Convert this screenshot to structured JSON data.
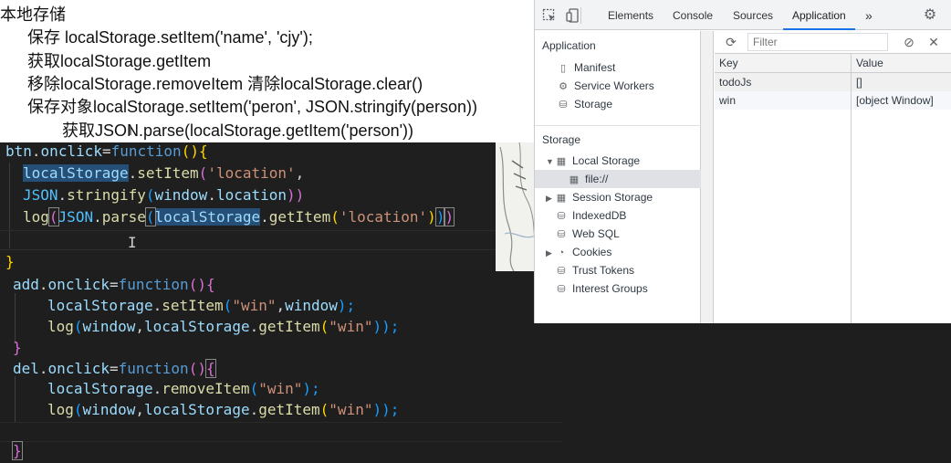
{
  "notes": {
    "heading": "本地存储",
    "lines": [
      "保存 localStorage.setItem('name', 'cjy');",
      "获取localStorage.getItem",
      "移除localStorage.removeItem  清除localStorage.clear()",
      "保存对象localStorage.setItem('peron', JSON.stringify(person))",
      "获取JSON.parse(localStorage.getItem('person'))"
    ]
  },
  "editor1": {
    "line1": {
      "a": "btn",
      "b": ".",
      "c": "onclick",
      "d": "=",
      "e": "function",
      "f": "(){"
    },
    "line2": {
      "a": "localStorage",
      "b": ".",
      "c": "setItem",
      "d": "(",
      "e": "'location'",
      "f": ","
    },
    "line3": {
      "a": "JSON",
      "b": ".",
      "c": "stringify",
      "d": "(",
      "e": "window",
      "f": ".",
      "g": "location",
      "h": "))"
    },
    "line4": {
      "a": "log",
      "b": "(",
      "c": "JSON",
      "d": ".",
      "e": "parse",
      "f": "(",
      "g": "localStorage",
      "h": ".",
      "i": "getItem",
      "j": "(",
      "k": "'location'",
      "l": ")",
      "m": ")",
      "n": ")"
    },
    "line5": "}"
  },
  "editor2": {
    "line1": {
      "a": "add",
      "b": ".",
      "c": "onclick",
      "d": "=",
      "e": "function",
      "f": "(){"
    },
    "line2": {
      "a": "localStorage",
      "b": ".",
      "c": "setItem",
      "d": "(",
      "e": "\"win\"",
      "f": ",",
      "g": "window",
      "h": ");"
    },
    "line3": {
      "a": "log",
      "b": "(",
      "c": "window",
      "d": ",",
      "e": "localStorage",
      "f": ".",
      "g": "getItem",
      "h": "(",
      "i": "\"win\"",
      "j": "));"
    },
    "line4": "}",
    "line5": {
      "a": "del",
      "b": ".",
      "c": "onclick",
      "d": "=",
      "e": "function",
      "f": "()",
      "g": "{"
    },
    "line6": {
      "a": "localStorage",
      "b": ".",
      "c": "removeItem",
      "d": "(",
      "e": "\"win\"",
      "f": ");"
    },
    "line7": {
      "a": "log",
      "b": "(",
      "c": "window",
      "d": ",",
      "e": "localStorage",
      "f": ".",
      "g": "getItem",
      "h": "(",
      "i": "\"win\"",
      "j": "));"
    },
    "line9": "}"
  },
  "devtools": {
    "tabs": [
      "Elements",
      "Console",
      "Sources",
      "Application"
    ],
    "active_tab": "Application",
    "more_tabs": "»",
    "sidebar": {
      "application_section": "Application",
      "application_items": [
        "Manifest",
        "Service Workers",
        "Storage"
      ],
      "storage_section": "Storage",
      "local_storage": "Local Storage",
      "local_storage_child": "file://",
      "storage_items": [
        "Session Storage",
        "IndexedDB",
        "Web SQL",
        "Cookies",
        "Trust Tokens",
        "Interest Groups"
      ]
    },
    "filter_placeholder": "Filter",
    "table": {
      "headers": [
        "Key",
        "Value"
      ],
      "rows": [
        {
          "key": "todoJs",
          "value": "[]"
        },
        {
          "key": "win",
          "value": "[object Window]"
        }
      ]
    }
  }
}
